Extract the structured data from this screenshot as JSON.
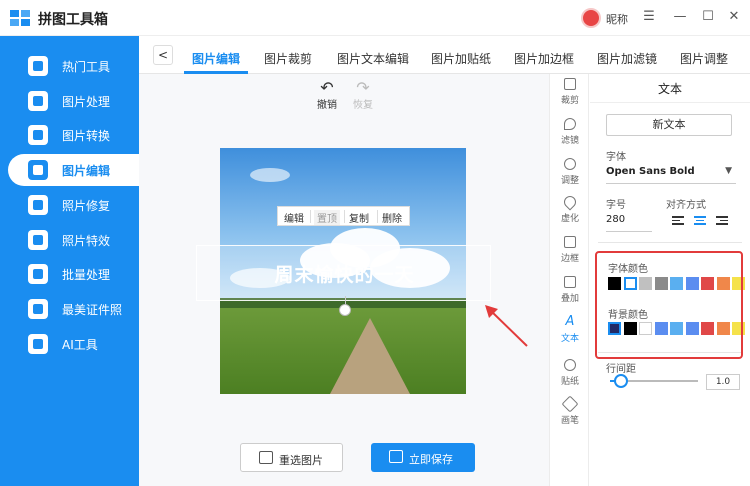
{
  "app": {
    "title": "拼图工具箱",
    "nickname": "昵称"
  },
  "window": {
    "menu_glyph": "☰",
    "min_glyph": "—",
    "max_glyph": "☐",
    "close_glyph": "✕"
  },
  "sidebar": {
    "items": [
      {
        "label": "热门工具",
        "icon": "tools-icon"
      },
      {
        "label": "图片处理",
        "icon": "image-process-icon"
      },
      {
        "label": "图片转换",
        "icon": "image-convert-icon"
      },
      {
        "label": "图片编辑",
        "icon": "image-edit-icon",
        "active": true
      },
      {
        "label": "照片修复",
        "icon": "photo-repair-icon"
      },
      {
        "label": "照片特效",
        "icon": "photo-effects-icon"
      },
      {
        "label": "批量处理",
        "icon": "batch-icon"
      },
      {
        "label": "最美证件照",
        "icon": "id-photo-icon"
      },
      {
        "label": "AI工具",
        "icon": "ai-icon"
      }
    ]
  },
  "tabs": {
    "back_glyph": "<",
    "items": [
      "图片编辑",
      "图片裁剪",
      "图片文本编辑",
      "图片加贴纸",
      "图片加边框",
      "图片加滤镜",
      "图片调整"
    ],
    "active_index": 0
  },
  "history": {
    "undo_label": "撤销",
    "redo_label": "恢复",
    "undo_glyph": "↶",
    "redo_glyph": "↷"
  },
  "context_menu": {
    "edit": "编辑",
    "top": "置顶",
    "copy": "复制",
    "delete": "删除"
  },
  "canvas": {
    "overlay_text": "周末愉快的一天"
  },
  "actions": {
    "reselect_label": "重选图片",
    "save_label": "立即保存"
  },
  "tools": [
    {
      "label": "裁剪",
      "icon": "crop-icon"
    },
    {
      "label": "滤镜",
      "icon": "filter-icon"
    },
    {
      "label": "调整",
      "icon": "adjust-icon"
    },
    {
      "label": "虚化",
      "icon": "blur-icon"
    },
    {
      "label": "边框",
      "icon": "frame-icon"
    },
    {
      "label": "叠加",
      "icon": "overlay-icon"
    },
    {
      "label": "文本",
      "icon": "text-icon",
      "active": true
    },
    {
      "label": "贴纸",
      "icon": "sticker-icon"
    },
    {
      "label": "画笔",
      "icon": "brush-icon"
    }
  ],
  "panel": {
    "title": "文本",
    "new_text_label": "新文本",
    "font_label": "字体",
    "font_value": "Open Sans Bold",
    "size_label": "字号",
    "size_value": "280",
    "align_label": "对齐方式",
    "align_active": "center",
    "font_color_label": "字体颜色",
    "font_colors": [
      "#000000",
      "#ffffff",
      "#c0c0c0",
      "#8a8a8a",
      "#5aaff0",
      "#5b8df0",
      "#e04848",
      "#f0874a",
      "#f5e24a"
    ],
    "font_color_selected": 1,
    "bg_color_label": "背景颜色",
    "bg_colors": [
      "#222a66",
      "#000000",
      "#ffffff",
      "#5b8df0",
      "#5aaff0",
      "#5b8df0",
      "#e04848",
      "#f0874a",
      "#f5e24a"
    ],
    "bg_color_selected": 0,
    "line_spacing_label": "行间距",
    "line_spacing_value": "1.0",
    "line_spacing_level": 0.12
  },
  "colors": {
    "accent": "#1a8df0",
    "highlight": "#e23b3b"
  }
}
